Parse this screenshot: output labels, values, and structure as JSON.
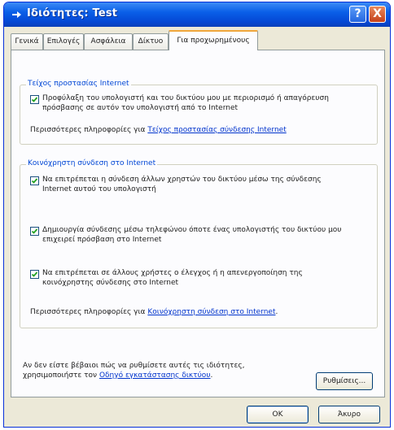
{
  "window": {
    "title": "Ιδιότητες: Test",
    "help_glyph": "?",
    "close_glyph": "X",
    "accent_colors": {
      "titlebar": "#0a5fe8",
      "close": "#c4401a",
      "link": "#0033cc",
      "group_title": "#0046d5"
    }
  },
  "tabs": [
    {
      "label": "Γενικά"
    },
    {
      "label": "Επιλογές"
    },
    {
      "label": "Ασφάλεια"
    },
    {
      "label": "Δίκτυο"
    },
    {
      "label": "Για προχωρημένους",
      "active": true
    }
  ],
  "firewall": {
    "title": "Τείχος προστασίας Internet",
    "checkbox": {
      "checked": true,
      "label": "Προφύλαξη του υπολογιστή και του δικτύου μου με περιορισμό ή απαγόρευση πρόσβασης σε αυτόν τον υπολογιστή από το Internet"
    },
    "more_info_prefix": "Περισσότερες πληροφορίες για",
    "more_info_link": "Τείχος προστασίας σύνδεσης Internet"
  },
  "ics": {
    "title": "Κοινόχρηστη σύνδεση στο Internet",
    "checkboxes": [
      {
        "checked": true,
        "label": "Να επιτρέπεται η σύνδεση άλλων χρηστών του δικτύου μέσω της σύνδεσης Internet αυτού του υπολογιστή"
      },
      {
        "checked": true,
        "label": "Δημιουργία σύνδεσης μέσω τηλεφώνου όποτε ένας υπολογιστής του δικτύου μου επιχειρεί πρόσβαση στο Internet"
      },
      {
        "checked": true,
        "label": "Να επιτρέπεται σε άλλους χρήστες ο έλεγχος ή η απενεργοποίηση της κοινόχρηστης σύνδεσης στο Internet"
      }
    ],
    "more_info_prefix": "Περισσότερες πληροφορίες για",
    "more_info_link": "Κοινόχρηστη σύνδεση στο Internet"
  },
  "footer": {
    "text": "Αν δεν είστε βέβαιοι πώς να ρυθμίσετε αυτές τις ιδιότητες, χρησιμοποιήστε τον",
    "wizard_link": "Οδηγό εγκατάστασης δικτύου",
    "text_end": ".",
    "settings_button": "Ρυθμίσεις..."
  },
  "buttons": {
    "ok": "OK",
    "cancel": "Άκυρο"
  }
}
